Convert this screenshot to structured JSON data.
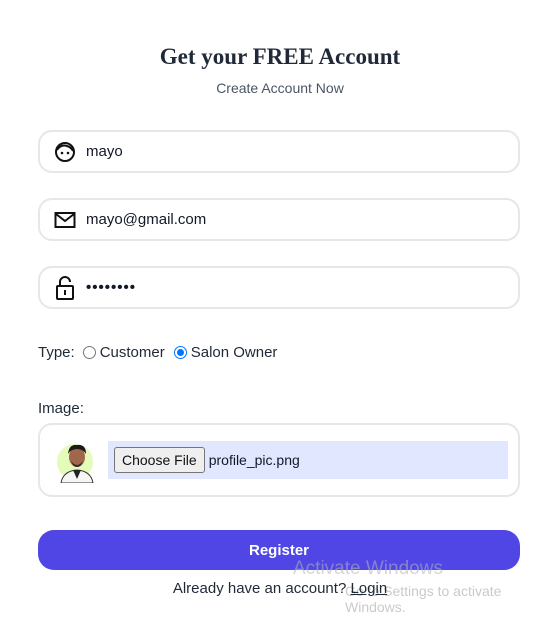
{
  "header": {
    "title": "Get your FREE Account",
    "subtitle": "Create Account Now"
  },
  "form": {
    "name": {
      "value": "mayo",
      "icon": "face-icon"
    },
    "email": {
      "value": "mayo@gmail.com",
      "icon": "mail-icon"
    },
    "password": {
      "value": "••••••••",
      "icon": "lock-icon"
    },
    "type": {
      "label": "Type:",
      "options": [
        {
          "label": "Customer",
          "checked": false
        },
        {
          "label": "Salon Owner",
          "checked": true
        }
      ]
    },
    "image": {
      "label": "Image:",
      "button_label": "Choose File",
      "file_name": "profile_pic.png"
    },
    "register_label": "Register"
  },
  "footer": {
    "prompt": "Already have an account?",
    "login_label": "Login"
  },
  "watermark": {
    "line1": "Activate Windows",
    "line2": "Go to Settings to activate Windows."
  },
  "colors": {
    "accent": "#4f46e5",
    "file_bg": "#e0e7ff",
    "border": "#e5e7eb"
  }
}
